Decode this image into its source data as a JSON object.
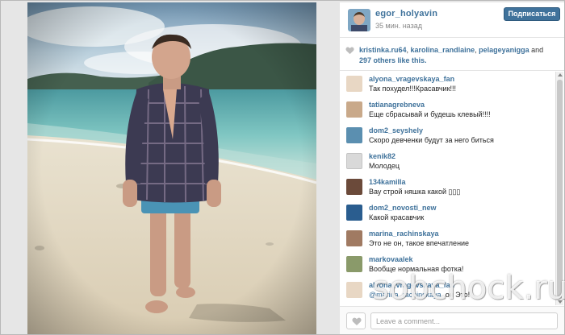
{
  "post": {
    "username": "egor_holyavin",
    "time": "35 мин. назад",
    "follow_label": "Подписаться"
  },
  "likes": {
    "users": [
      "kristinka.ru64",
      "karolina_randlaine",
      "pelageyanigga"
    ],
    "sep1": ", ",
    "sep2": ", ",
    "and_label": " and ",
    "others": "297 others like this.",
    "icon": "heart-icon"
  },
  "comments": [
    {
      "user": "alyona_vragevskaya_fan",
      "text": "Так похудел!!!Красавчик!!!",
      "avatar_color": "#e8d7c4"
    },
    {
      "user": "tatianagrebneva",
      "text": "Еще сбрасывай и будешь клевый!!!!",
      "avatar_color": "#c9a98a"
    },
    {
      "user": "dom2_seyshely",
      "text": "Скоро девченки будут за него биться",
      "avatar_color": "#5b8fb0"
    },
    {
      "user": "kenik82",
      "text": "Молодец",
      "avatar_color": "#d9d9d9"
    },
    {
      "user": "134kamilla",
      "text": "Вау строй няшка какой ▯▯▯",
      "avatar_color": "#6b4a3a"
    },
    {
      "user": "dom2_novosti_new",
      "text": "Какой красавчик",
      "avatar_color": "#2a5d8f"
    },
    {
      "user": "marina_rachinskaya",
      "text": "Это не он, такое впечатление",
      "avatar_color": "#a07a62"
    },
    {
      "user": "markovaalek",
      "text": "Вообще нормальная фотка!",
      "avatar_color": "#8a9a6a"
    },
    {
      "user": "alyona_vragevskaya_fan",
      "mention": "@marina_rachinskaya",
      "text": " ,он Это!",
      "avatar_color": "#e8d7c4"
    }
  ],
  "footer": {
    "placeholder": "Leave a comment...",
    "like_icon": "heart-icon"
  },
  "watermark": "sobchock.ru",
  "colors": {
    "link": "#3f729b",
    "button": "#3f729b"
  }
}
